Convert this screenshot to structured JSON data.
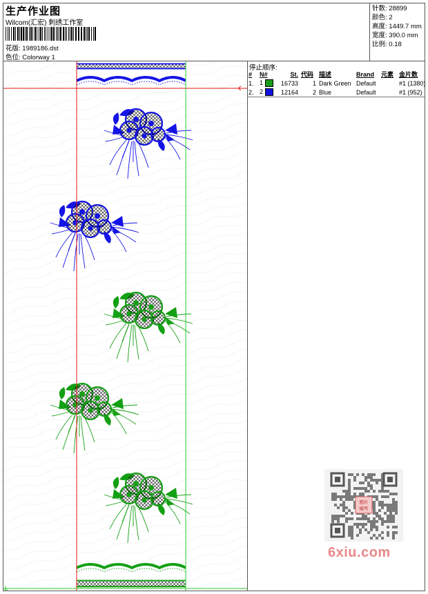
{
  "header": {
    "title": "生产作业图",
    "company": "Wilcom(汇宏) 刺绣工作室",
    "design_label": "花版:",
    "design_value": "1989186.dst",
    "colorway_label": "色位:",
    "colorway_value": "Colorway 1"
  },
  "stats": {
    "stitches_label": "针数:",
    "stitches_value": "28899",
    "colors_label": "颜色:",
    "colors_value": "2",
    "height_label": "高度:",
    "height_value": "1449.7 mm",
    "width_label": "宽度:",
    "width_value": "390.0 mm",
    "scale_label": "比例:",
    "scale_value": "0.18"
  },
  "stop_sequence": {
    "title": "停止顺序:",
    "columns": [
      "#",
      "N#",
      "St.",
      "代码",
      "描述",
      "Brand",
      "元素",
      "金片数"
    ],
    "rows": [
      {
        "idx": "1.",
        "n": "1",
        "color": "#1a9a1a",
        "st": "16733",
        "code": "1",
        "desc": "Dark Green",
        "brand": "Default",
        "element": "",
        "sequins": "#1 (1380)"
      },
      {
        "idx": "2.",
        "n": "2",
        "color": "#1010e0",
        "st": "12164",
        "code": "2",
        "desc": "Blue",
        "brand": "Default",
        "element": "",
        "sequins": "#1 (952)"
      }
    ]
  },
  "colors": {
    "green": "#14a014",
    "blue": "#1414e6",
    "guide_red": "#e01414",
    "guide_green": "#2cc82c"
  },
  "watermark": {
    "qr_badge": "图片编号",
    "site": "6xiu.com"
  }
}
